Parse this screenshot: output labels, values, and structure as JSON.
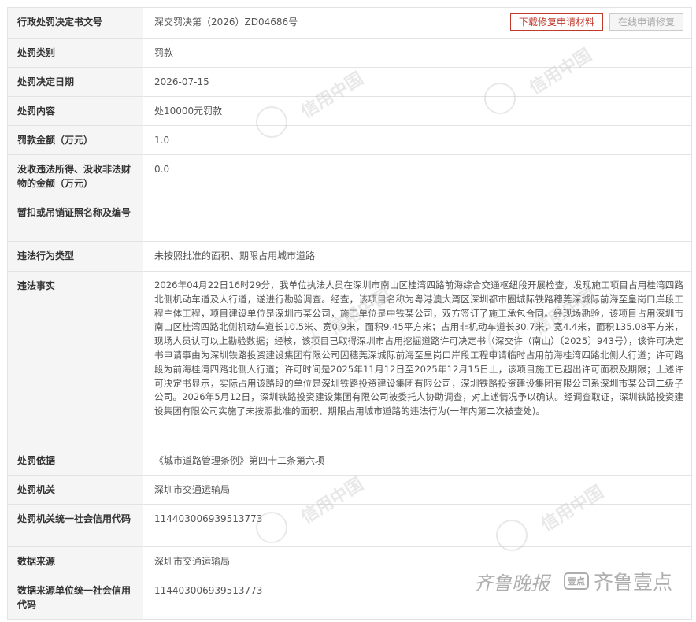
{
  "record": {
    "rows": [
      {
        "label": "行政处罚决定书文号",
        "value": "深交罚决第（2026）ZD04686号"
      },
      {
        "label": "处罚类别",
        "value": "罚款"
      },
      {
        "label": "处罚决定日期",
        "value": "2026-07-15"
      },
      {
        "label": "处罚内容",
        "value": "处10000元罚款"
      },
      {
        "label": "罚款金额（万元）",
        "value": "1.0"
      },
      {
        "label": "没收违法所得、没收非法财物的金额（万元）",
        "value": "0.0"
      },
      {
        "label": "暂扣或吊销证照名称及编号",
        "value": "— —"
      },
      {
        "label": "违法行为类型",
        "value": "未按照批准的面积、期限占用城市道路"
      },
      {
        "label": "违法事实",
        "value": "2026年04月22日16时29分，我单位执法人员在深圳市南山区桂湾四路前海综合交通枢纽段开展检查，发现施工项目占用桂湾四路北侧机动车道及人行道，遂进行勘验调查。经查，该项目名称为粤港澳大湾区深圳都市圈城际铁路穗莞深城际前海至皇岗口岸段工程主体工程，项目建设单位是深圳市某公司，施工单位是中铁某公司，双方签订了施工承包合同。经现场勘验，该项目占用深圳市南山区桂湾四路北侧机动车道长10.5米、宽0.9米，面积9.45平方米；占用非机动车道长30.7米，宽4.4米，面积135.08平方米，现场人员认可以上勘验数据；经核，该项目已取得深圳市占用挖掘道路许可决定书（深交许（南山）〔2025〕943号），该许可决定书申请事由为深圳铁路投资建设集团有限公司因穗莞深城际前海至皇岗口岸段工程申请临时占用前海桂湾四路北侧人行道；许可路段为前海桂湾四路北侧人行道；许可时间是2025年11月12日至2025年12月15日止，该项目施工已超出许可面积及期限；上述许可决定书显示，实际占用该路段的单位是深圳铁路投资建设集团有限公司，深圳铁路投资建设集团有限公司系深圳市某公司二级子公司。2026年5月12日，深圳铁路投资建设集团有限公司被委托人协助调查，对上述情况予以确认。经调查取证，深圳铁路投资建设集团有限公司实施了未按照批准的面积、期限占用城市道路的违法行为(一年内第二次被查处)。"
      },
      {
        "label": "处罚依据",
        "value": "《城市道路管理条例》第四十二条第六项"
      },
      {
        "label": "处罚机关",
        "value": "深圳市交通运输局"
      },
      {
        "label": "处罚机关统一社会信用代码",
        "value": "114403006939513773"
      },
      {
        "label": "数据来源",
        "value": "深圳市交通运输局"
      },
      {
        "label": "数据来源单位统一社会信用代码",
        "value": "114403006939513773"
      }
    ]
  },
  "actions": {
    "download_label": "下载修复申请材料",
    "online_label": "在线申请修复"
  },
  "watermark": {
    "text": "信用中国"
  },
  "footer": {
    "brand_script": "齐鲁晚报",
    "brand_badge": "壹点",
    "brand_name": "齐鲁壹点"
  },
  "colors": {
    "label_bg": "#f5f5f5",
    "border": "#e3e3e3",
    "accent_red": "#c0392b"
  }
}
